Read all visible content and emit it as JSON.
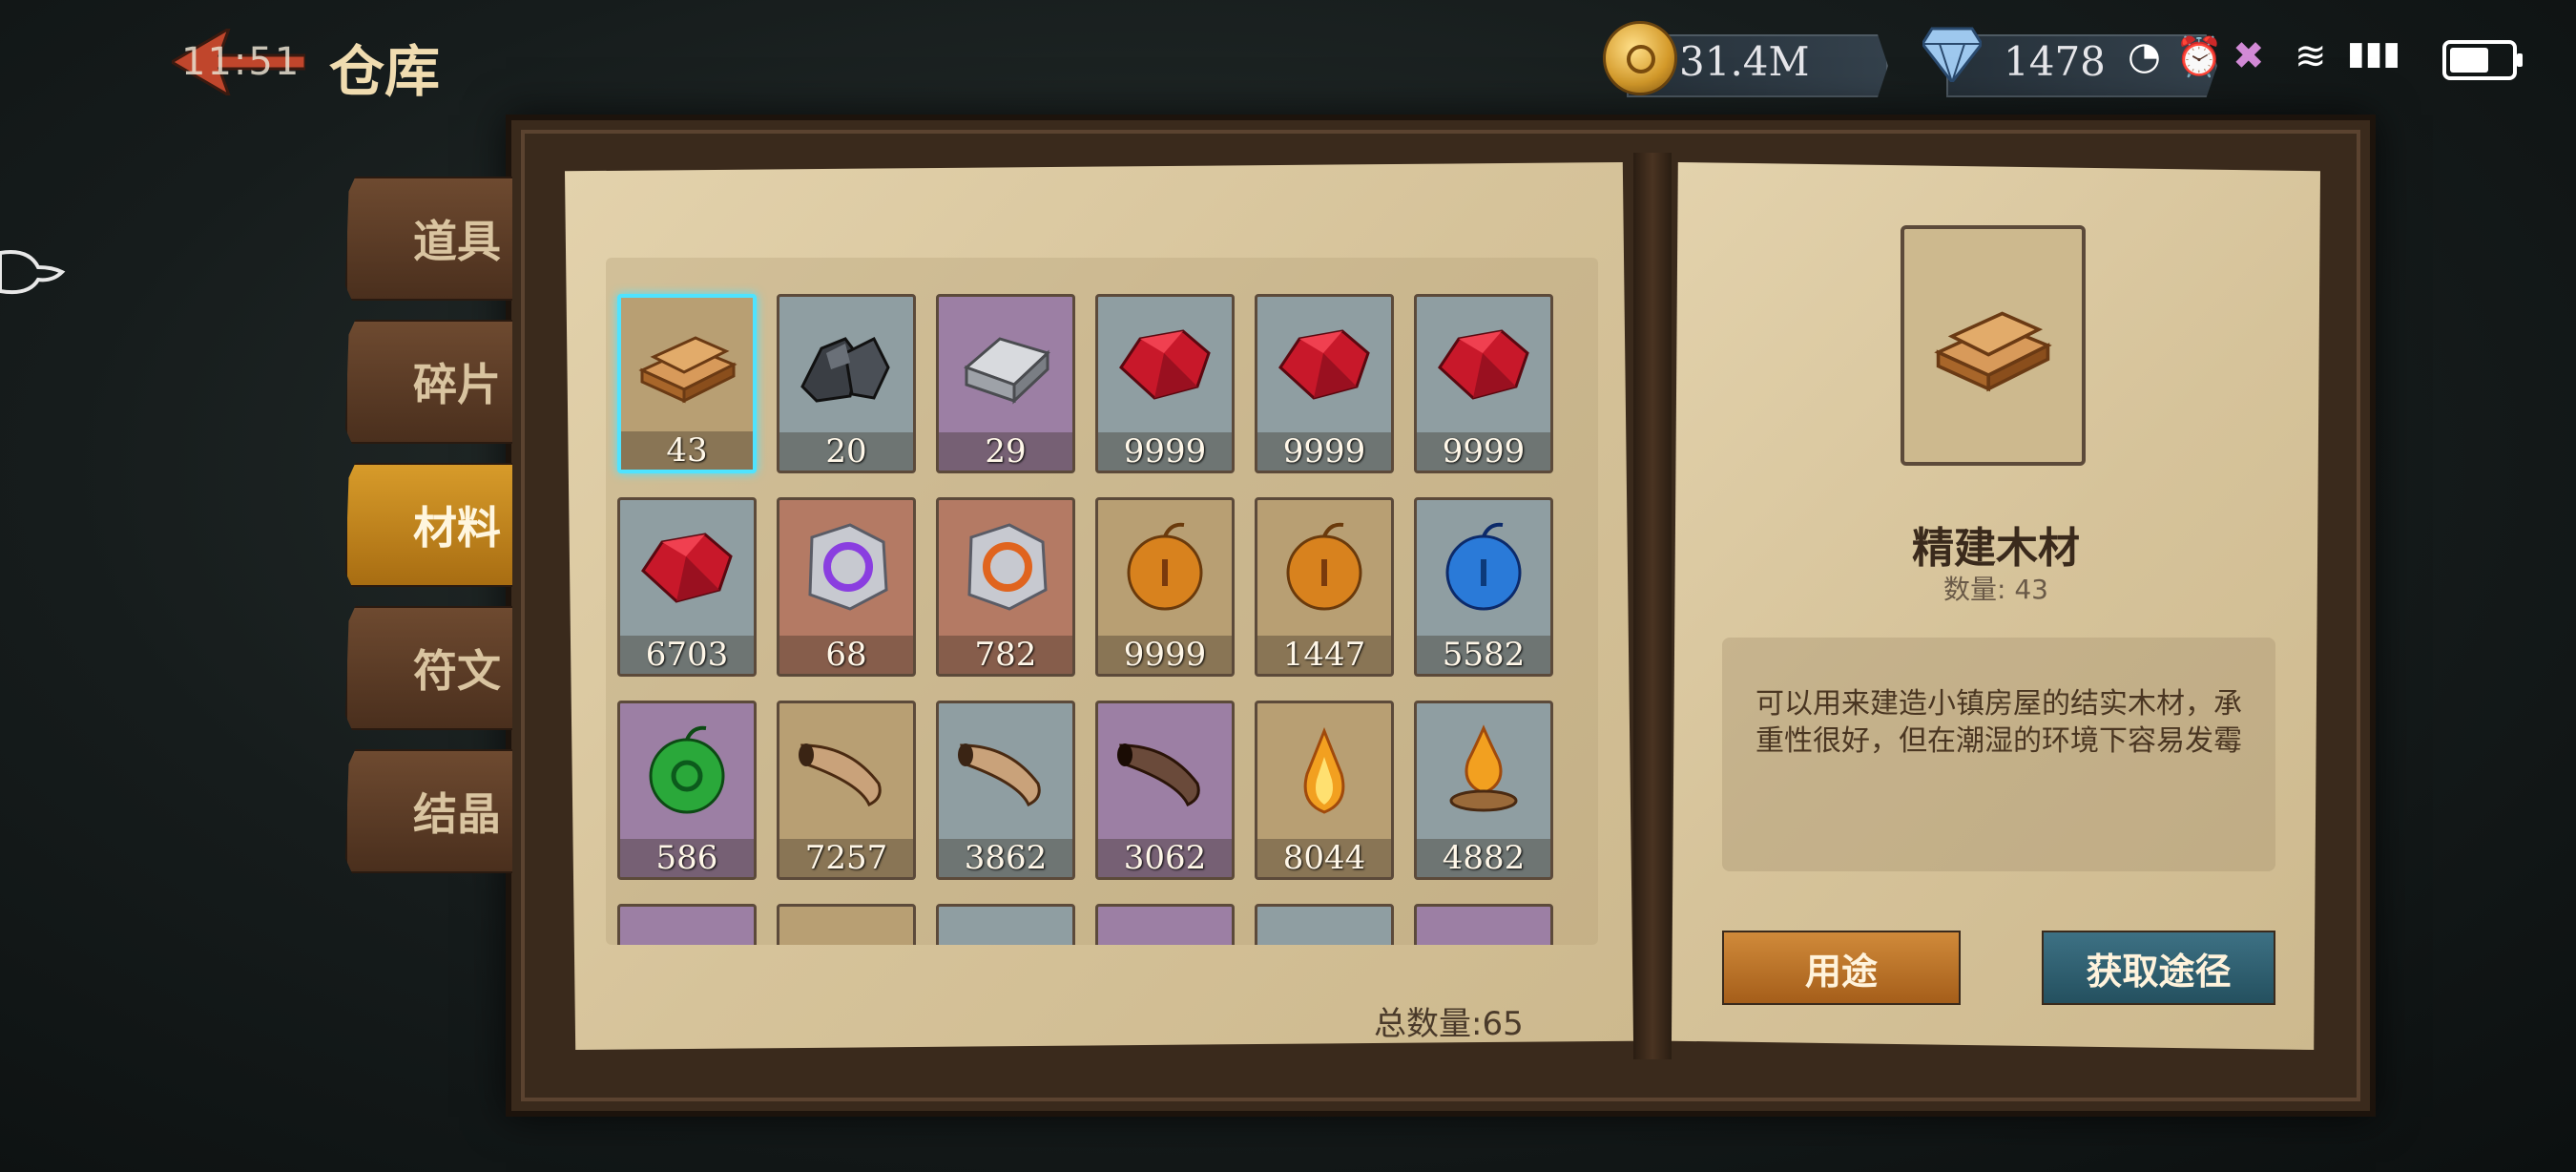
{
  "header": {
    "status_time": "11:51",
    "title": "仓库",
    "coins": "31.4M",
    "gems": "1478"
  },
  "tabs": [
    {
      "label": "道具",
      "active": false
    },
    {
      "label": "碎片",
      "active": false
    },
    {
      "label": "材料",
      "active": true
    },
    {
      "label": "符文",
      "active": false
    },
    {
      "label": "结晶",
      "active": false
    }
  ],
  "items": [
    {
      "icon": "wood-planks-icon",
      "count": "43",
      "bg": "#b89f73",
      "selected": true
    },
    {
      "icon": "coal-ore-icon",
      "count": "20",
      "bg": "#8f9ea2"
    },
    {
      "icon": "iron-ingot-icon",
      "count": "29",
      "bg": "#9c7fa4"
    },
    {
      "icon": "red-gem-icon",
      "count": "9999",
      "bg": "#8f9ea2"
    },
    {
      "icon": "red-gem-icon",
      "count": "9999",
      "bg": "#8f9ea2"
    },
    {
      "icon": "red-gem-icon",
      "count": "9999",
      "bg": "#8f9ea2"
    },
    {
      "icon": "red-gem-icon",
      "count": "6703",
      "bg": "#8f9ea2"
    },
    {
      "icon": "purple-rune-stone-icon",
      "count": "68",
      "bg": "#b47a64"
    },
    {
      "icon": "orange-rune-stone-icon",
      "count": "782",
      "bg": "#b47a64"
    },
    {
      "icon": "golden-apple-icon",
      "count": "9999",
      "bg": "#b89f73"
    },
    {
      "icon": "golden-apple-icon",
      "count": "1447",
      "bg": "#b89f73"
    },
    {
      "icon": "blue-apple-icon",
      "count": "5582",
      "bg": "#8f9ea2"
    },
    {
      "icon": "green-apple-icon",
      "count": "586",
      "bg": "#9c7fa4"
    },
    {
      "icon": "horn-icon",
      "count": "7257",
      "bg": "#b89f73"
    },
    {
      "icon": "horn-icon",
      "count": "3862",
      "bg": "#8f9ea2"
    },
    {
      "icon": "dark-horn-icon",
      "count": "3062",
      "bg": "#9c7fa4"
    },
    {
      "icon": "flame-icon",
      "count": "8044",
      "bg": "#b89f73"
    },
    {
      "icon": "brazier-flame-icon",
      "count": "4882",
      "bg": "#8f9ea2"
    },
    {
      "icon": "",
      "count": "",
      "bg": "#9c7fa4"
    },
    {
      "icon": "",
      "count": "",
      "bg": "#b89f73"
    },
    {
      "icon": "",
      "count": "",
      "bg": "#8f9ea2"
    },
    {
      "icon": "",
      "count": "",
      "bg": "#9c7fa4"
    },
    {
      "icon": "",
      "count": "",
      "bg": "#8f9ea2"
    },
    {
      "icon": "",
      "count": "",
      "bg": "#9c7fa4"
    }
  ],
  "total": "总数量:65",
  "detail": {
    "name": "精建木材",
    "quantity": "数量:  43",
    "description": "可以用来建造小镇房屋的结实木材，承重性很好，但在潮湿的环境下容易发霉",
    "use_label": "用途",
    "obtain_label": "获取途径"
  }
}
